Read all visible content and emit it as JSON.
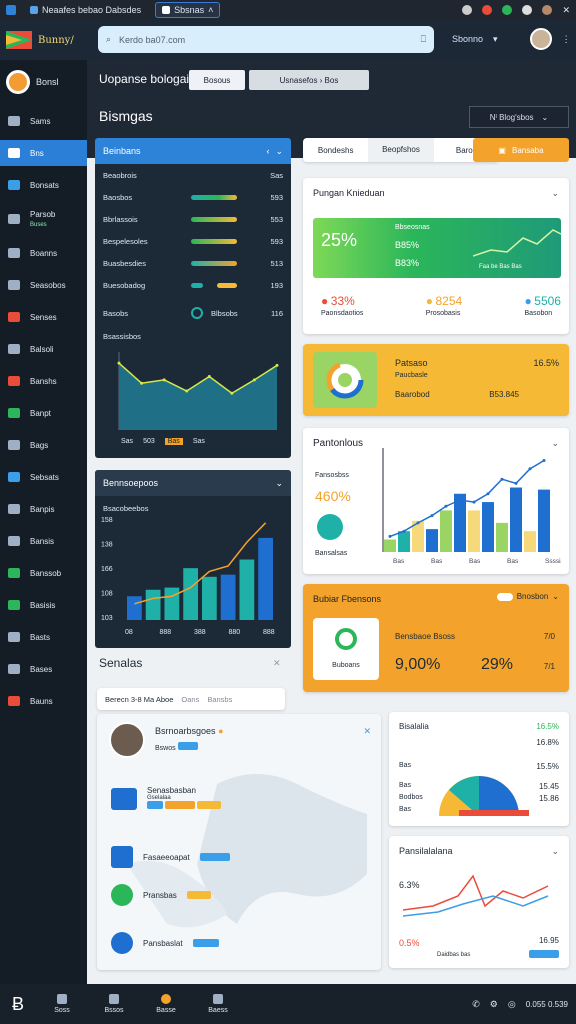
{
  "browser": {
    "tab1": "Neaafes bebao Dabsdes",
    "tab2": "Sbsnas"
  },
  "header": {
    "app_name": "Bunny/",
    "search_placeholder": "Kerdo ba07.com",
    "user_label": "Sbonno"
  },
  "sidebar": {
    "brand": "Bonsl",
    "items": [
      {
        "label": "Sams"
      },
      {
        "label": "Bns"
      },
      {
        "label": "Bonsats"
      },
      {
        "label": "Parsob",
        "sub": "Buses"
      },
      {
        "label": "Boanns"
      },
      {
        "label": "Seasobos"
      },
      {
        "label": "Senses"
      },
      {
        "label": "Balsoli"
      },
      {
        "label": "Banshs"
      },
      {
        "label": "Banpt"
      },
      {
        "label": "Bags"
      },
      {
        "label": "Sebsats"
      },
      {
        "label": "Banpis"
      },
      {
        "label": "Bansis"
      },
      {
        "label": "Banssob"
      },
      {
        "label": "Basisis"
      },
      {
        "label": "Basts"
      },
      {
        "label": "Bases"
      },
      {
        "label": "Bauns"
      }
    ]
  },
  "titlebar": {
    "title": "Uopanse bologai",
    "pill1": "Bosous",
    "pill2": "Usnasefos  ›  Bos",
    "heading": "Bismgas",
    "dropdown": "Nᴵ Blogʹsbos"
  },
  "left_panel1": {
    "title": "Beinbans",
    "header_row": {
      "label": "Beaobrois",
      "value": "Sas"
    },
    "rows": [
      {
        "label": "Baosbos",
        "value": "593"
      },
      {
        "label": "Bbrlassois",
        "value": "553"
      },
      {
        "label": "Bespelesoles",
        "value": "593"
      },
      {
        "label": "Buasbesdies",
        "value": "513"
      },
      {
        "label": "Buesobadog",
        "value": "193"
      },
      {
        "label": "Basobs",
        "value": "116"
      },
      {
        "label": "Bsassisbos",
        "value": ""
      }
    ],
    "row6_mid": "Blbsobs",
    "legend": [
      "Sas",
      "503",
      "Bas",
      "Sas"
    ]
  },
  "left_panel2": {
    "title": "Bennsoepoos",
    "subtitle": "Bsacobeebos",
    "yticks": [
      "158",
      "138",
      "166",
      "108",
      "103"
    ],
    "xticks": [
      "08",
      "888",
      "388",
      "880",
      "888"
    ]
  },
  "section": {
    "title": "Senalas",
    "tabs": [
      "Berecn 3-8 Ma Aboe",
      "Oans",
      "Bansbs"
    ]
  },
  "profile": {
    "name": "Bsrnoarbsgoes",
    "sub": "Bswos",
    "items": [
      {
        "label": "Senasbasban"
      },
      {
        "label": "Fasaeeoapat"
      },
      {
        "label": "Pransbas"
      },
      {
        "label": "Pansbaslat"
      }
    ],
    "sub2": "Gselalaa"
  },
  "right_top": {
    "tabs": [
      "Bondeshs",
      "Beopfshos",
      "Baros"
    ],
    "btn": "Bansaba"
  },
  "stats_card": {
    "title": "Pungan Knieduan",
    "big": "25%",
    "line1": "B85%",
    "line2": "B83%",
    "label_top": "Bbseosnas",
    "label_right": "Faa be  Bas  Bas",
    "metrics": [
      {
        "v": "33%",
        "l": "Paonsdaotios"
      },
      {
        "v": "8254",
        "l": "Prosobasis"
      },
      {
        "v": "5506",
        "l": "Basobon"
      }
    ]
  },
  "yellow_card1": {
    "title": "Patsaso",
    "sub": "Paucbasle",
    "line": "Baarobod",
    "v1": "16.5%",
    "v2": "B53.845"
  },
  "bar_card": {
    "title": "Pantonlous",
    "left_label": "Fansosbss",
    "big": "460%",
    "sub": "Bansalsas",
    "ticks": [
      "Bas",
      "5as",
      "5as",
      "Soo"
    ],
    "bottom_ticks": [
      "Bas",
      "Bas",
      "Bas",
      "Bas",
      "Ssssias"
    ]
  },
  "orange_card": {
    "title": "Bubiar Fbensons",
    "btn": "Bnosbon",
    "label": "Bensbaoe Bsoss",
    "icon_label": "Buboans",
    "v1": "9,00%",
    "v2": "29%",
    "v3": "7/0",
    "v4": "7/1"
  },
  "small_card1": {
    "title": "Bisalalia",
    "v": [
      "16.5%",
      "16.8%",
      "15.5%",
      "15.45",
      "15.86"
    ],
    "l": [
      "Bodbos",
      "Bas",
      "Bas",
      "Bas"
    ]
  },
  "small_card2": {
    "title": "Pansilalalana",
    "v1": "6.3%",
    "v2": "0.5%",
    "v3": "16.95",
    "sub": "Daidbas bas"
  },
  "bottom": {
    "items": [
      "Soss",
      "Bssos",
      "Basse",
      "Baess"
    ],
    "right": "0.055 0.539"
  },
  "colors": {
    "accent": "#2c83d8",
    "green": "#2bb65a",
    "yellow": "#f5b935",
    "orange": "#f3a32b",
    "dark": "#1c2a38"
  },
  "chart_data": [
    {
      "type": "area",
      "title": "Beinbans",
      "x": [
        1,
        2,
        3,
        4,
        5,
        6,
        7,
        8
      ],
      "values": [
        60,
        42,
        45,
        35,
        48,
        33,
        45,
        58
      ],
      "ylim": [
        0,
        70
      ]
    },
    {
      "type": "bar",
      "title": "Bennsoepoos",
      "categories": [
        "08",
        "888",
        "388",
        "880",
        "888"
      ],
      "values": [
        22,
        28,
        30,
        48,
        40,
        42,
        56,
        76
      ],
      "line": [
        15,
        20,
        22,
        30,
        45,
        50,
        72,
        90
      ],
      "ylim": [
        0,
        100
      ]
    },
    {
      "type": "bar",
      "title": "Pantonlous",
      "values": [
        12,
        20,
        30,
        22,
        40,
        56,
        40,
        48,
        28,
        62,
        20,
        60
      ],
      "line": [
        15,
        20,
        28,
        35,
        44,
        50,
        48,
        56,
        70,
        66,
        80,
        88
      ],
      "ylim": [
        0,
        100
      ]
    }
  ]
}
